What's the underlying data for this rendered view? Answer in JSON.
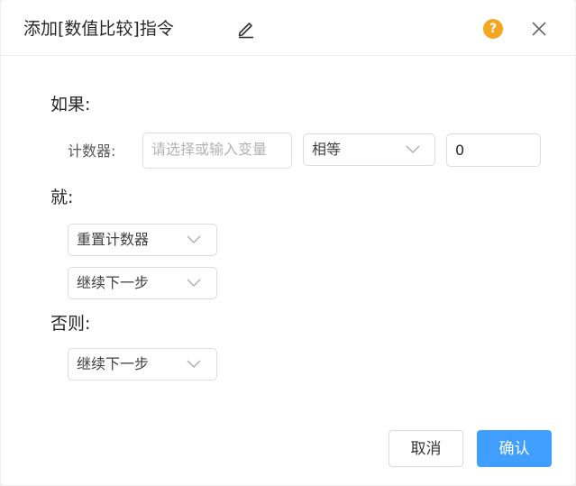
{
  "dialog": {
    "title": "添加[数值比较]指令"
  },
  "icons": {
    "edit": "edit-pencil-icon",
    "help": "help-question-icon",
    "close": "close-x-icon",
    "chevron": "chevron-down-icon",
    "help_glyph": "?"
  },
  "sections": {
    "if_label": "如果:",
    "then_label": "就:",
    "else_label": "否则:"
  },
  "condition": {
    "field_label": "计数器:",
    "variable_placeholder": "请选择或输入变量",
    "operator_selected": "相等",
    "compare_value": "0"
  },
  "then_actions": [
    {
      "selected": "重置计数器"
    },
    {
      "selected": "继续下一步"
    }
  ],
  "else_actions": [
    {
      "selected": "继续下一步"
    }
  ],
  "footer": {
    "cancel_label": "取消",
    "confirm_label": "确认"
  },
  "colors": {
    "primary": "#409eff",
    "help": "#f5a623"
  }
}
